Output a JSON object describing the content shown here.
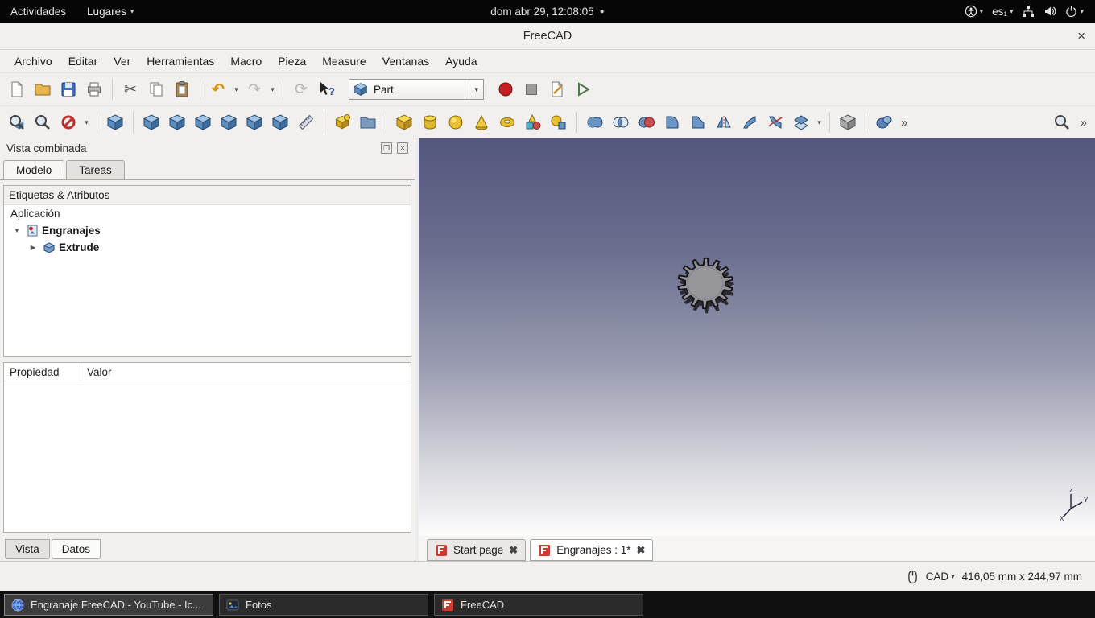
{
  "glyphs": {
    "close": "×",
    "tab_close": "✖",
    "chevron_down": "▾",
    "overflow": "»",
    "record_dot": "●",
    "tree_expanded": "▼",
    "tree_collapsed": "▶",
    "undo": "↶",
    "redo": "↷",
    "refresh": "⟳",
    "scissors": "✂",
    "help_cursor": "?",
    "float_panel": "❐"
  },
  "topbar": {
    "activities": "Actividades",
    "places": "Lugares",
    "clock": "dom abr 29, 12:08:05",
    "keyboard_layout": "es₁"
  },
  "window": {
    "title": "FreeCAD"
  },
  "menubar": {
    "items": [
      "Archivo",
      "Editar",
      "Ver",
      "Herramientas",
      "Macro",
      "Pieza",
      "Measure",
      "Ventanas",
      "Ayuda"
    ]
  },
  "toolbar": {
    "workbench_selector": "Part",
    "standard_icons": [
      "new",
      "open",
      "save",
      "print",
      "cut",
      "copy",
      "paste",
      "undo",
      "redo",
      "refresh",
      "whats-this",
      "macro-record",
      "macro-stop",
      "macro-edit",
      "macro-play"
    ],
    "view_icons": [
      "fit-all",
      "fit-selection",
      "draw-style",
      "axonometric",
      "view-front",
      "view-top",
      "view-right",
      "view-rear",
      "view-bottom",
      "view-left",
      "measure"
    ],
    "part_icons": [
      "create-part",
      "create-group",
      "box",
      "cylinder",
      "sphere",
      "cone",
      "torus",
      "primitives",
      "shape-builder",
      "boolean-union",
      "boolean-intersection",
      "boolean-cut",
      "fillet",
      "chamfer",
      "mirror",
      "loft",
      "sweep",
      "offset",
      "compound",
      "check-geometry"
    ]
  },
  "combined_view": {
    "title": "Vista combinada",
    "tabs": {
      "model": "Modelo",
      "tasks": "Tareas"
    },
    "tree_header": "Etiquetas & Atributos",
    "tree": {
      "root": "Aplicación",
      "document": "Engranajes",
      "child": "Extrude"
    },
    "properties": {
      "col_property": "Propiedad",
      "col_value": "Valor"
    },
    "bottom_tabs": {
      "view": "Vista",
      "data": "Datos"
    }
  },
  "viewport": {
    "tabs": [
      {
        "label": "Start page"
      },
      {
        "label": "Engranajes : 1*"
      }
    ],
    "axis": {
      "x": "X",
      "y": "Y",
      "z": "Z"
    }
  },
  "statusbar": {
    "nav_style": "CAD",
    "dimensions": "416,05 mm x 244,97 mm"
  },
  "taskbar": {
    "items": [
      {
        "label": "Engranaje FreeCAD - YouTube - Ic..."
      },
      {
        "label": "Fotos"
      },
      {
        "label": "FreeCAD"
      }
    ]
  }
}
